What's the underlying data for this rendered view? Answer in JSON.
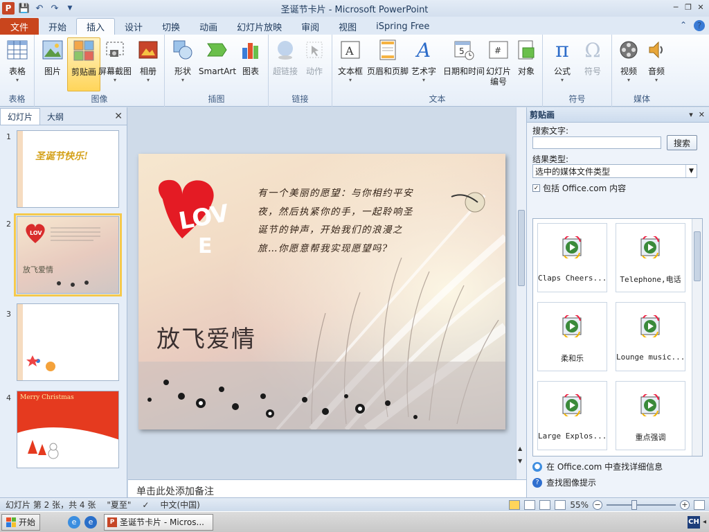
{
  "window": {
    "title": "圣诞节卡片 - Microsoft PowerPoint",
    "app_icon_letter": "P"
  },
  "tabs": [
    {
      "label": "文件",
      "active": false
    },
    {
      "label": "开始",
      "active": false
    },
    {
      "label": "插入",
      "active": true
    },
    {
      "label": "设计",
      "active": false
    },
    {
      "label": "切换",
      "active": false
    },
    {
      "label": "动画",
      "active": false
    },
    {
      "label": "幻灯片放映",
      "active": false
    },
    {
      "label": "审阅",
      "active": false
    },
    {
      "label": "视图",
      "active": false
    },
    {
      "label": "iSpring Free",
      "active": false
    }
  ],
  "ribbon": {
    "groups": {
      "table": "表格",
      "image": "图像",
      "illustrations": "插图",
      "links": "链接",
      "text": "文本",
      "symbols": "符号",
      "media": "媒体"
    },
    "buttons": {
      "table": "表格",
      "picture": "图片",
      "clipart": "剪贴画",
      "screenshot": "屏幕截图",
      "album": "相册",
      "shapes": "形状",
      "smartart": "SmartArt",
      "chart": "图表",
      "hyperlink": "超链接",
      "action": "动作",
      "textbox": "文本框",
      "header_footer": "页眉和页脚",
      "wordart": "艺术字",
      "datetime": "日期和时间",
      "slide_number_1": "幻灯片",
      "slide_number_2": "编号",
      "object": "对象",
      "equation": "公式",
      "symbol": "符号",
      "video": "视频",
      "audio": "音频"
    }
  },
  "left_panel": {
    "tab_slides": "幻灯片",
    "tab_outline": "大纲",
    "close": "✕",
    "slides": [
      {
        "num": "1",
        "text": "圣诞节快乐!"
      },
      {
        "num": "2",
        "text": ""
      },
      {
        "num": "3",
        "text": ""
      },
      {
        "num": "4",
        "text": "Merry Christmas"
      }
    ]
  },
  "slide": {
    "heart_text_1": "LOV",
    "heart_text_2": "E",
    "body": "有一个美丽的愿望：与你相约平安夜，然后执紧你的手，一起聆响圣诞节的钟声，开始我们的浪漫之旅…你愿意帮我实现愿望吗?",
    "title": "放飞爱情"
  },
  "notes_placeholder": "单击此处添加备注",
  "clipart_pane": {
    "title": "剪贴画",
    "search_label": "搜索文字:",
    "search_value": "",
    "search_button": "搜索",
    "result_type_label": "结果类型:",
    "result_type_value": "选中的媒体文件类型",
    "include_office": "包括 Office.com 内容",
    "include_checked": true,
    "results": [
      {
        "label": "Claps Cheers..."
      },
      {
        "label": "Telephone,电话"
      },
      {
        "label": "柔和乐"
      },
      {
        "label": "Lounge music..."
      },
      {
        "label": "Large Explos..."
      },
      {
        "label": "重点强调"
      }
    ],
    "link_office": "在 Office.com 中查找详细信息",
    "link_tips": "查找图像提示"
  },
  "statusbar": {
    "slide_info": "幻灯片 第 2 张，共 4 张",
    "theme": "\"夏至\"",
    "language": "中文(中国)",
    "zoom": "55%"
  },
  "taskbar": {
    "start": "开始",
    "task": "圣诞节卡片 - Micros...",
    "ime": "CH"
  }
}
